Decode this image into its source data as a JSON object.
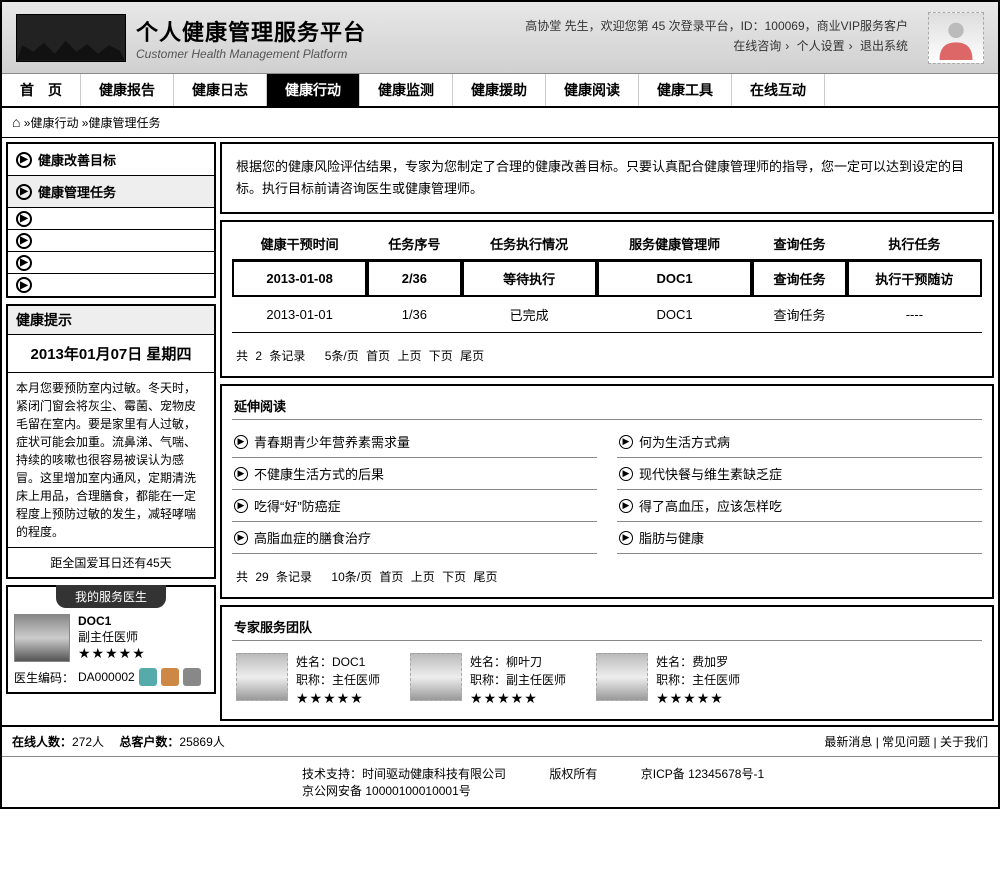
{
  "header": {
    "title_zh": "个人健康管理服务平台",
    "title_en": "Customer Health Management Platform",
    "welcome_line1_a": "高协堂 先生，欢迎您第 45 次登录平台，ID：100069，商业VIP服务客户",
    "links": {
      "online": "在线咨询",
      "settings": "个人设置",
      "logout": "退出系统"
    }
  },
  "nav": [
    "首　页",
    "健康报告",
    "健康日志",
    "健康行动",
    "健康监测",
    "健康援助",
    "健康阅读",
    "健康工具",
    "在线互动"
  ],
  "nav_active_index": 3,
  "breadcrumb": {
    "home_icon": "⌂",
    "path": " »健康行动 »健康管理任务"
  },
  "sidebar_menu": [
    "健康改善目标",
    "健康管理任务"
  ],
  "tip": {
    "head": "健康提示",
    "date": "2013年01月07日 星期四",
    "body": "本月您要预防室内过敏。冬天时，紧闭门窗会将灰尘、霉菌、宠物皮毛留在室内。要是家里有人过敏，症状可能会加重。流鼻涕、气喘、持续的咳嗽也很容易被误认为感冒。这里增加室内通风，定期清洗床上用品，合理膳食，都能在一定程度上预防过敏的发生，减轻哮喘的程度。",
    "foot": "距全国爱耳日还有45天"
  },
  "mydoc": {
    "tab": "我的服务医生",
    "name": "DOC1",
    "title": "副主任医师",
    "stars": "★★★★★",
    "code_label": "医生编码：",
    "code": "DA000002"
  },
  "notice": "根据您的健康风险评估结果，专家为您制定了合理的健康改善目标。只要认真配合健康管理师的指导，您一定可以达到设定的目标。执行目标前请咨询医生或健康管理师。",
  "task_table": {
    "headers": [
      "健康干预时间",
      "任务序号",
      "任务执行情况",
      "服务健康管理师",
      "查询任务",
      "执行任务"
    ],
    "rows": [
      {
        "hl": true,
        "cells": [
          "2013-01-08",
          "2/36",
          "等待执行",
          "DOC1",
          "查询任务",
          "执行干预随访"
        ]
      },
      {
        "hl": false,
        "cells": [
          "2013-01-01",
          "1/36",
          "已完成",
          "DOC1",
          "查询任务",
          "----"
        ]
      }
    ],
    "pager": {
      "total_prefix": "共 ",
      "total": "2",
      "total_suffix": " 条记录　",
      "per": "5条/页",
      "first": "首页",
      "prev": "上页",
      "next": "下页",
      "last": "尾页"
    }
  },
  "reading": {
    "head": "延伸阅读",
    "left": [
      "青春期青少年营养素需求量",
      "不健康生活方式的后果",
      "吃得“好”防癌症",
      "高脂血症的膳食治疗"
    ],
    "right": [
      "何为生活方式病",
      "现代快餐与维生素缺乏症",
      "得了高血压，应该怎样吃",
      "脂肪与健康"
    ],
    "pager": {
      "total_prefix": "共 ",
      "total": "29",
      "total_suffix": " 条记录　",
      "per": "10条/页",
      "first": "首页",
      "prev": "上页",
      "next": "下页",
      "last": "尾页"
    }
  },
  "team": {
    "head": "专家服务团队",
    "name_label": "姓名：",
    "title_label": "职称：",
    "members": [
      {
        "name": "DOC1",
        "title": "主任医师",
        "stars": "★★★★★"
      },
      {
        "name": "柳叶刀",
        "title": "副主任医师",
        "stars": "★★★★★"
      },
      {
        "name": "费加罗",
        "title": "主任医师",
        "stars": "★★★★★"
      }
    ]
  },
  "footer1": {
    "online_label": "在线人数：",
    "online": "272人",
    "total_label": "　总客户数：",
    "total": "25869人",
    "links": [
      "最新消息",
      "常见问题",
      "关于我们"
    ]
  },
  "footer2": {
    "tech_label": "技术支持：",
    "tech": "时间驱动健康科技有限公司",
    "copy": "版权所有",
    "icp_label": "京ICP备 ",
    "icp": "12345678号-1",
    "gongan_label": "京公网安备 ",
    "gongan": "10000100010001号"
  }
}
